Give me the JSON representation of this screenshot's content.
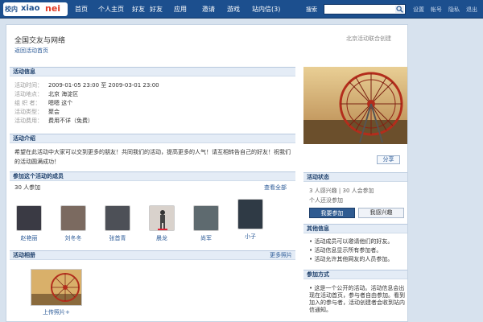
{
  "topbar": {
    "logo": {
      "part1": "校内",
      "part2": "xiao",
      "part3": "nei"
    },
    "nav": [
      "首页",
      "个人主页",
      "好友",
      "好友",
      "应用",
      "邀请",
      "游戏",
      "站内信(3)"
    ],
    "search_label": "搜索",
    "search_value": "",
    "right_links": [
      "设置",
      "帐号",
      "隐私",
      "退出"
    ]
  },
  "page": {
    "title": "全国交友与网络",
    "back_link": "返回活动首页",
    "opened_by": "北京活动联合创建"
  },
  "info": {
    "heading": "活动信息",
    "rows": [
      {
        "k": "活动时间：",
        "v": "2009-01-05 23:00 至 2009-03-01 23:00"
      },
      {
        "k": "活动地点：",
        "v": "北京 海淀区"
      },
      {
        "k": "组 织 者：",
        "v": "嗯嗯  这个"
      },
      {
        "k": "活动类型：",
        "v": "聚会"
      },
      {
        "k": "活动费用：",
        "v": "费用不详（免费）"
      }
    ]
  },
  "intro": {
    "heading": "活动介绍",
    "text": "希望在此活动中大家可以交到更多的朋友！共同我们的活动，提高更多的人气！请互相转告自己的好友！祝我们的活动圆满成功！"
  },
  "members": {
    "heading": "参加这个活动的成员",
    "count": "30 人参加",
    "view_all": "查看全部",
    "list": [
      {
        "name": "赵艳丽",
        "color": "#3a3a44"
      },
      {
        "name": "刘冬冬",
        "color": "#7b6a60"
      },
      {
        "name": "张首青",
        "color": "#4d5057"
      },
      {
        "name": "晨龙",
        "color": "#d9d2cc"
      },
      {
        "name": "尚军",
        "color": "#5e6a6f"
      },
      {
        "name": "小子",
        "color": "#2f3a45"
      }
    ]
  },
  "photos": {
    "heading": "活动相册",
    "more": "更多照片",
    "upload": "上传照片+"
  },
  "sidebar": {
    "share": "分享",
    "status_heading": "活动状态",
    "status_line1": "3 人感兴趣 | 30 人会参加",
    "status_line2": "个人还没参加",
    "join_button": "我要参加",
    "interest_button": "我感兴趣",
    "other_heading": "其他信息",
    "other_items": [
      "活动成员可以邀请他们的好友。",
      "活动信息显示所有参加者。",
      "活动允许其他网友的人员参加。"
    ],
    "how_heading": "参加方式",
    "how_text": "• 这是一个公开的活动。活动信息会出现在活动首页，参与者自由参加。看到加入的参与者，活动创建者会收到站内信通知。"
  },
  "colors": {
    "topbar": "#1c4f8e",
    "accent_link": "#2b5a97",
    "section_bg": "#e4ecf6"
  }
}
